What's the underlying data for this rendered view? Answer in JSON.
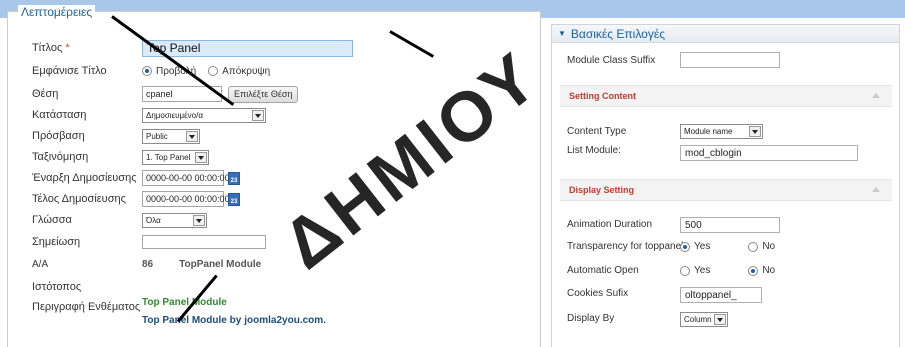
{
  "left": {
    "legend": "Λεπτομέρειες",
    "fields": {
      "title_label": "Τίτλος",
      "title_required": "*",
      "title_value": "Top Panel",
      "show_title_label": "Εμφάνισε Τίτλο",
      "show_title_opt1": "Προβολή",
      "show_title_opt2": "Απόκρυψη",
      "position_label": "Θέση",
      "position_value": "cpanel",
      "position_button": "Επιλέξτε Θέση",
      "state_label": "Κατάσταση",
      "state_value": "Δημοσιευμένο/α",
      "access_label": "Πρόσβαση",
      "access_value": "Public",
      "ordering_label": "Ταξινόμηση",
      "ordering_value": "1. Top Panel",
      "publish_up_label": "Έναρξη Δημοσίευσης",
      "publish_up_value": "0000-00-00 00:00:00",
      "publish_down_label": "Τέλος Δημοσίευσης",
      "publish_down_value": "0000-00-00 00:00:00",
      "language_label": "Γλώσσα",
      "language_value": "Όλα",
      "note_label": "Σημείωση",
      "note_value": "",
      "id_label": "Α/Α",
      "id_value": "86",
      "id_module": "TopPanel Module",
      "site_label": "Ιστότοπος",
      "desc_label": "Περιγραφή Ενθέματος",
      "desc_title": "Top Panel Module",
      "desc_text": "Top Panel Module by",
      "desc_link": "joomla2you.com."
    }
  },
  "right": {
    "header": "Βασικές Επιλογές",
    "module_class_suffix_label": "Module Class Suffix",
    "module_class_suffix_value": "",
    "section_content": "Setting Content",
    "content_type_label": "Content Type",
    "content_type_value": "Module name",
    "list_module_label": "List Module:",
    "list_module_value": "mod_cblogin",
    "section_display": "Display Setting",
    "animation_label": "Animation Duration",
    "animation_value": "500",
    "transparency_label": "Transparency for toppanel",
    "yes": "Yes",
    "no": "No",
    "auto_open_label": "Automatic Open",
    "cookies_label": "Cookies Sufix",
    "cookies_value": "oltoppanel_",
    "display_by_label": "Display By",
    "display_by_value": "Column"
  },
  "watermark": "ΔΗΜΙΟΥ",
  "icons": [
    "calendar-icon",
    "dropdown-arrow-icon",
    "collapse-caret-icon",
    "expand-triangle-icon"
  ],
  "colors": {
    "accent_blue": "#1a61a6",
    "section_red": "#c23b2f",
    "green": "#2e8b2e",
    "top_strip": "#a9c8e9"
  }
}
